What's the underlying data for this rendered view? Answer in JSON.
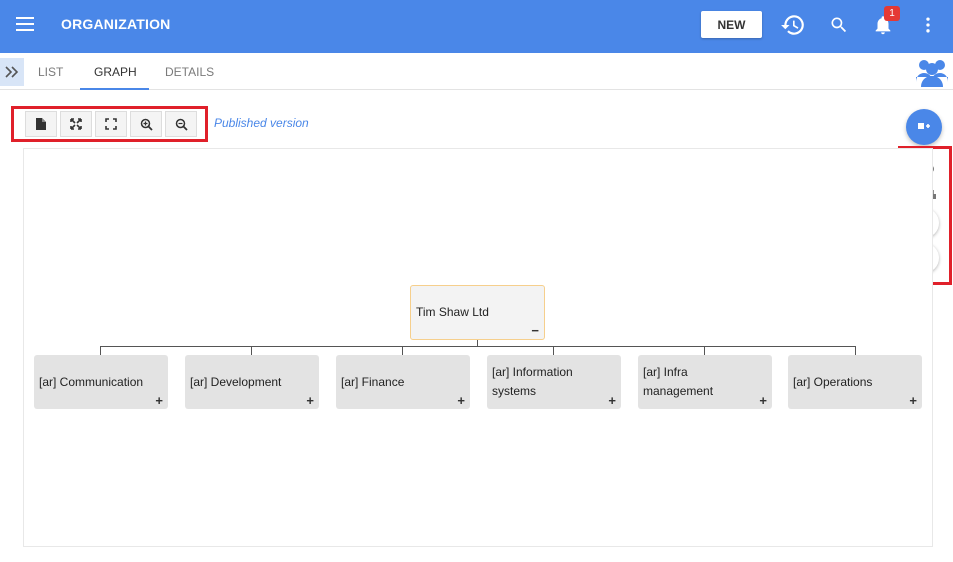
{
  "header": {
    "title": "ORGANIZATION",
    "new_label": "NEW",
    "notification_count": "1"
  },
  "tabs": [
    {
      "label": "LIST",
      "active": false
    },
    {
      "label": "GRAPH",
      "active": true
    },
    {
      "label": "DETAILS",
      "active": false
    }
  ],
  "toolbar": {
    "buttons": [
      "export-document-icon",
      "fit-to-screen-icon",
      "fullscreen-icon",
      "zoom-in-icon",
      "zoom-out-icon"
    ],
    "version_label": "Published version"
  },
  "right_tools": [
    "add-icon",
    "graph-layout-icon",
    "hierarchy-layout-icon",
    "share-icon",
    "notifications-off-icon"
  ],
  "org_chart": {
    "root": {
      "label": "Tim Shaw Ltd",
      "control": "−"
    },
    "children": [
      {
        "label": "[ar] Communication",
        "control": "+"
      },
      {
        "label": "[ar] Development",
        "control": "+"
      },
      {
        "label": "[ar] Finance",
        "control": "+"
      },
      {
        "label": "[ar] Information systems",
        "control": "+"
      },
      {
        "label": "[ar] Infra management",
        "control": "+"
      },
      {
        "label": "[ar] Operations",
        "control": "+"
      }
    ]
  },
  "colors": {
    "header": "#4a87e8",
    "highlight": "#e0202a",
    "badge": "#e53935"
  }
}
